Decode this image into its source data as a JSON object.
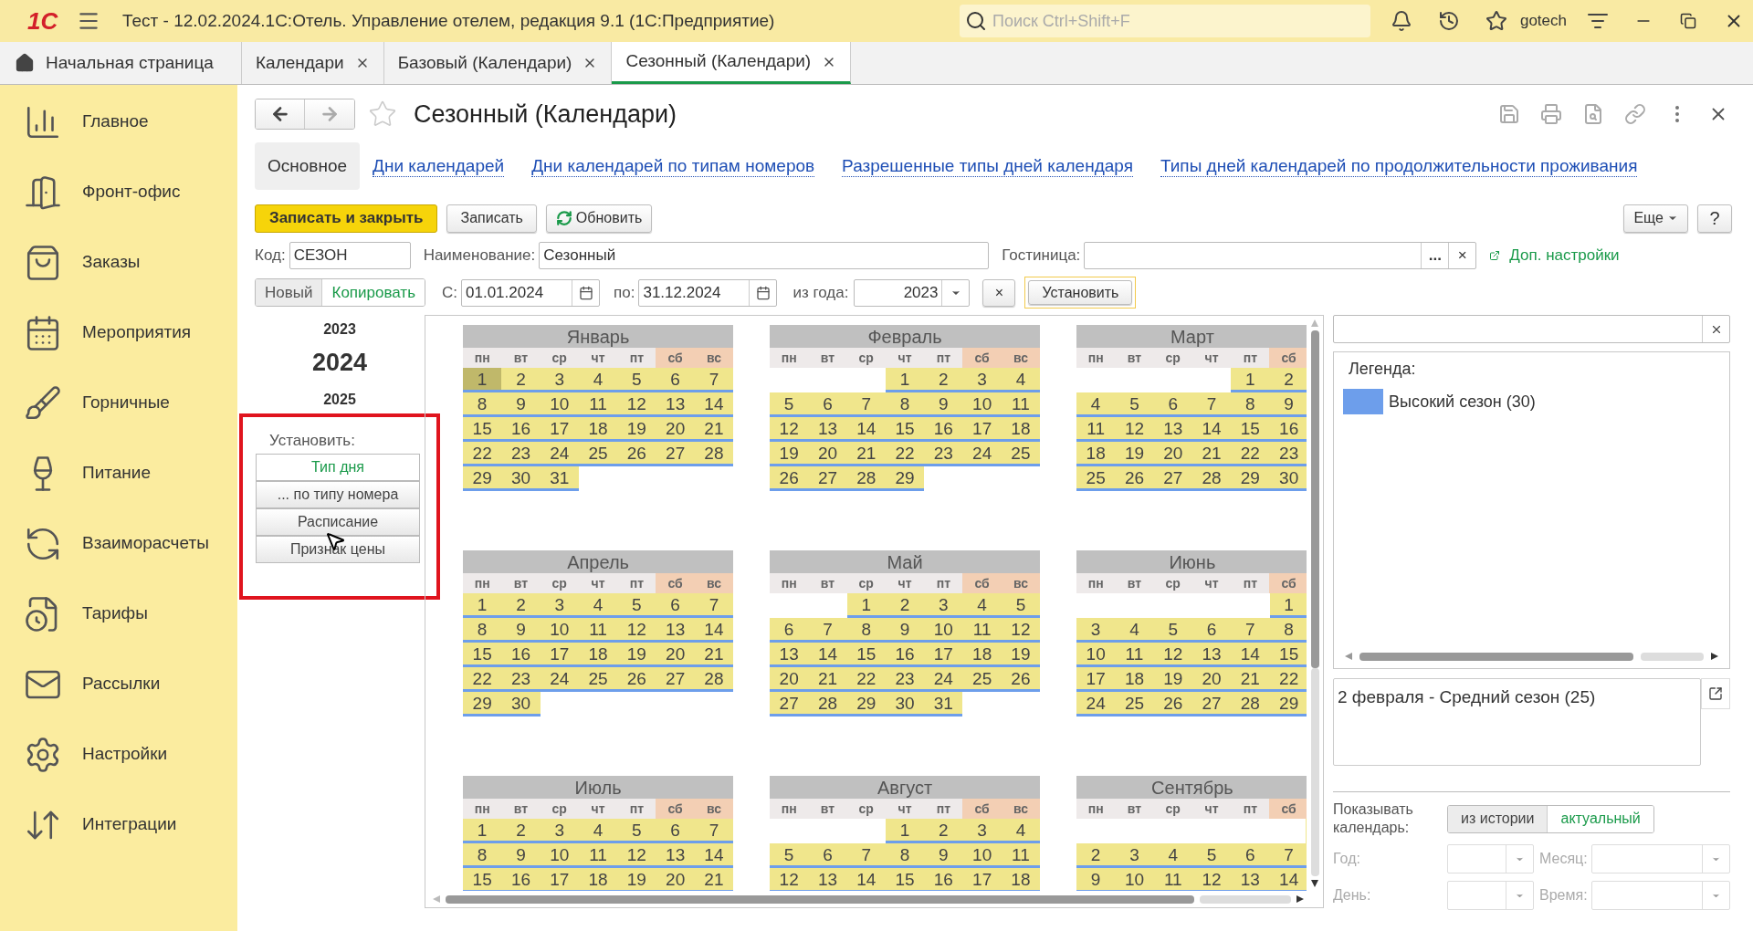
{
  "app_bar": {
    "logo": "1С",
    "title": "Тест - 12.02.2024.1С:Отель. Управление отелем, редакция 9.1  (1С:Предприятие)",
    "search": {
      "placeholder": "Поиск Ctrl+Shift+F"
    },
    "user": "gotech"
  },
  "open_tabs": [
    {
      "label": "Начальная страница",
      "kind": "home",
      "selected": false
    },
    {
      "label": "Календари",
      "kind": "doc",
      "selected": false
    },
    {
      "label": "Базовый (Календари)",
      "kind": "doc",
      "selected": false
    },
    {
      "label": "Сезонный (Календари)",
      "kind": "doc",
      "selected": true
    }
  ],
  "sidebar": {
    "items": [
      {
        "label": "Главное"
      },
      {
        "label": "Фронт-офис"
      },
      {
        "label": "Заказы"
      },
      {
        "label": "Мероприятия"
      },
      {
        "label": "Горничные"
      },
      {
        "label": "Питание"
      },
      {
        "label": "Взаиморасчеты"
      },
      {
        "label": "Тарифы"
      },
      {
        "label": "Рассылки"
      },
      {
        "label": "Настройки"
      },
      {
        "label": "Интеграции"
      }
    ]
  },
  "form": {
    "title": "Сезонный (Календари)",
    "sections": [
      {
        "label": "Основное",
        "selected": true
      },
      {
        "label": "Дни календарей",
        "selected": false
      },
      {
        "label": "Дни календарей по типам номеров",
        "selected": false
      },
      {
        "label": "Разрешенные типы дней календаря",
        "selected": false
      },
      {
        "label": "Типы дней календарей по продолжительности проживания",
        "selected": false
      }
    ],
    "commands": {
      "save_close": "Записать и закрыть",
      "save": "Записать",
      "refresh": "Обновить",
      "more": "Еще",
      "help": "?"
    },
    "fields": {
      "code_label": "Код:",
      "code": "СЕЗОН",
      "name_label": "Наименование:",
      "name": "Сезонный",
      "hotel_label": "Гостиница:",
      "hotel_choose": "...",
      "hotel_clear": "×",
      "extra_settings": "Доп. настройки"
    },
    "mode_toggle": [
      {
        "label": "Новый",
        "selected": false
      },
      {
        "label": "Копировать",
        "selected": true
      }
    ],
    "period": {
      "from_label": "С:",
      "from": "01.01.2024",
      "to_label": "по:",
      "to": "31.12.2024",
      "year_label": "из года:",
      "year": "2023",
      "clear": "×",
      "apply": "Установить"
    },
    "years": [
      {
        "label": "2023",
        "selected": false
      },
      {
        "label": "2024",
        "selected": true
      },
      {
        "label": "2025",
        "selected": false
      }
    ],
    "set_label": "Установить:",
    "set_buttons": [
      {
        "label": "Тип дня",
        "selected": true
      },
      {
        "label": "... по типу номера",
        "selected": false
      },
      {
        "label": "Расписание",
        "selected": false
      },
      {
        "label": "Признак цены",
        "selected": false
      }
    ],
    "months": [
      {
        "title": "Январь",
        "weekdays": [
          {
            "label": "пн",
            "weekend": false
          },
          {
            "label": "вт",
            "weekend": false
          },
          {
            "label": "ср",
            "weekend": false
          },
          {
            "label": "чт",
            "weekend": false
          },
          {
            "label": "пт",
            "weekend": false
          },
          {
            "label": "сб",
            "weekend": true
          },
          {
            "label": "вс",
            "weekend": true
          }
        ],
        "weeks": [
          [
            {
              "day": "1",
              "selected": true
            },
            {
              "day": "2",
              "selected": false
            },
            {
              "day": "3",
              "selected": false
            },
            {
              "day": "4",
              "selected": false
            },
            {
              "day": "5",
              "selected": false
            },
            {
              "day": "6",
              "selected": false
            },
            {
              "day": "7",
              "selected": false
            }
          ],
          [
            {
              "day": "8",
              "selected": false
            },
            {
              "day": "9",
              "selected": false
            },
            {
              "day": "10",
              "selected": false
            },
            {
              "day": "11",
              "selected": false
            },
            {
              "day": "12",
              "selected": false
            },
            {
              "day": "13",
              "selected": false
            },
            {
              "day": "14",
              "selected": false
            }
          ],
          [
            {
              "day": "15",
              "selected": false
            },
            {
              "day": "16",
              "selected": false
            },
            {
              "day": "17",
              "selected": false
            },
            {
              "day": "18",
              "selected": false
            },
            {
              "day": "19",
              "selected": false
            },
            {
              "day": "20",
              "selected": false
            },
            {
              "day": "21",
              "selected": false
            }
          ],
          [
            {
              "day": "22",
              "selected": false
            },
            {
              "day": "23",
              "selected": false
            },
            {
              "day": "24",
              "selected": false
            },
            {
              "day": "25",
              "selected": false
            },
            {
              "day": "26",
              "selected": false
            },
            {
              "day": "27",
              "selected": false
            },
            {
              "day": "28",
              "selected": false
            }
          ],
          [
            {
              "day": "29",
              "selected": false
            },
            {
              "day": "30",
              "selected": false
            },
            {
              "day": "31",
              "selected": false
            }
          ]
        ]
      },
      {
        "title": "Февраль",
        "weekdays": [
          {
            "label": "пн",
            "weekend": false
          },
          {
            "label": "вт",
            "weekend": false
          },
          {
            "label": "ср",
            "weekend": false
          },
          {
            "label": "чт",
            "weekend": false
          },
          {
            "label": "пт",
            "weekend": false
          },
          {
            "label": "сб",
            "weekend": true
          },
          {
            "label": "вс",
            "weekend": true
          }
        ],
        "weeks": [
          [
            {
              "day": "1",
              "selected": false
            },
            {
              "day": "2",
              "selected": false
            },
            {
              "day": "3",
              "selected": false
            },
            {
              "day": "4",
              "selected": false
            }
          ],
          [
            {
              "day": "5",
              "selected": false
            },
            {
              "day": "6",
              "selected": false
            },
            {
              "day": "7",
              "selected": false
            },
            {
              "day": "8",
              "selected": false
            },
            {
              "day": "9",
              "selected": false
            },
            {
              "day": "10",
              "selected": false
            },
            {
              "day": "11",
              "selected": false
            }
          ],
          [
            {
              "day": "12",
              "selected": false
            },
            {
              "day": "13",
              "selected": false
            },
            {
              "day": "14",
              "selected": false
            },
            {
              "day": "15",
              "selected": false
            },
            {
              "day": "16",
              "selected": false
            },
            {
              "day": "17",
              "selected": false
            },
            {
              "day": "18",
              "selected": false
            }
          ],
          [
            {
              "day": "19",
              "selected": false
            },
            {
              "day": "20",
              "selected": false
            },
            {
              "day": "21",
              "selected": false
            },
            {
              "day": "22",
              "selected": false
            },
            {
              "day": "23",
              "selected": false
            },
            {
              "day": "24",
              "selected": false
            },
            {
              "day": "25",
              "selected": false
            }
          ],
          [
            {
              "day": "26",
              "selected": false
            },
            {
              "day": "27",
              "selected": false
            },
            {
              "day": "28",
              "selected": false
            },
            {
              "day": "29",
              "selected": false
            }
          ]
        ]
      },
      {
        "title": "Март",
        "weekdays": [
          {
            "label": "пн",
            "weekend": false
          },
          {
            "label": "вт",
            "weekend": false
          },
          {
            "label": "ср",
            "weekend": false
          },
          {
            "label": "чт",
            "weekend": false
          },
          {
            "label": "пт",
            "weekend": false
          },
          {
            "label": "сб",
            "weekend": true
          }
        ],
        "weeks": [
          [
            {
              "day": "1",
              "selected": false
            },
            {
              "day": "2",
              "selected": false
            }
          ],
          [
            {
              "day": "4",
              "selected": false
            },
            {
              "day": "5",
              "selected": false
            },
            {
              "day": "6",
              "selected": false
            },
            {
              "day": "7",
              "selected": false
            },
            {
              "day": "8",
              "selected": false
            },
            {
              "day": "9",
              "selected": false
            }
          ],
          [
            {
              "day": "11",
              "selected": false
            },
            {
              "day": "12",
              "selected": false
            },
            {
              "day": "13",
              "selected": false
            },
            {
              "day": "14",
              "selected": false
            },
            {
              "day": "15",
              "selected": false
            },
            {
              "day": "16",
              "selected": false
            }
          ],
          [
            {
              "day": "18",
              "selected": false
            },
            {
              "day": "19",
              "selected": false
            },
            {
              "day": "20",
              "selected": false
            },
            {
              "day": "21",
              "selected": false
            },
            {
              "day": "22",
              "selected": false
            },
            {
              "day": "23",
              "selected": false
            }
          ],
          [
            {
              "day": "25",
              "selected": false
            },
            {
              "day": "26",
              "selected": false
            },
            {
              "day": "27",
              "selected": false
            },
            {
              "day": "28",
              "selected": false
            },
            {
              "day": "29",
              "selected": false
            },
            {
              "day": "30",
              "selected": false
            }
          ]
        ]
      },
      {
        "title": "Апрель",
        "weekdays": [
          {
            "label": "пн",
            "weekend": false
          },
          {
            "label": "вт",
            "weekend": false
          },
          {
            "label": "ср",
            "weekend": false
          },
          {
            "label": "чт",
            "weekend": false
          },
          {
            "label": "пт",
            "weekend": false
          },
          {
            "label": "сб",
            "weekend": true
          },
          {
            "label": "вс",
            "weekend": true
          }
        ],
        "weeks": [
          [
            {
              "day": "1",
              "selected": false
            },
            {
              "day": "2",
              "selected": false
            },
            {
              "day": "3",
              "selected": false
            },
            {
              "day": "4",
              "selected": false
            },
            {
              "day": "5",
              "selected": false
            },
            {
              "day": "6",
              "selected": false
            },
            {
              "day": "7",
              "selected": false
            }
          ],
          [
            {
              "day": "8",
              "selected": false
            },
            {
              "day": "9",
              "selected": false
            },
            {
              "day": "10",
              "selected": false
            },
            {
              "day": "11",
              "selected": false
            },
            {
              "day": "12",
              "selected": false
            },
            {
              "day": "13",
              "selected": false
            },
            {
              "day": "14",
              "selected": false
            }
          ],
          [
            {
              "day": "15",
              "selected": false
            },
            {
              "day": "16",
              "selected": false
            },
            {
              "day": "17",
              "selected": false
            },
            {
              "day": "18",
              "selected": false
            },
            {
              "day": "19",
              "selected": false
            },
            {
              "day": "20",
              "selected": false
            },
            {
              "day": "21",
              "selected": false
            }
          ],
          [
            {
              "day": "22",
              "selected": false
            },
            {
              "day": "23",
              "selected": false
            },
            {
              "day": "24",
              "selected": false
            },
            {
              "day": "25",
              "selected": false
            },
            {
              "day": "26",
              "selected": false
            },
            {
              "day": "27",
              "selected": false
            },
            {
              "day": "28",
              "selected": false
            }
          ],
          [
            {
              "day": "29",
              "selected": false
            },
            {
              "day": "30",
              "selected": false
            }
          ]
        ]
      },
      {
        "title": "Май",
        "weekdays": [
          {
            "label": "пн",
            "weekend": false
          },
          {
            "label": "вт",
            "weekend": false
          },
          {
            "label": "ср",
            "weekend": false
          },
          {
            "label": "чт",
            "weekend": false
          },
          {
            "label": "пт",
            "weekend": false
          },
          {
            "label": "сб",
            "weekend": true
          },
          {
            "label": "вс",
            "weekend": true
          }
        ],
        "weeks": [
          [
            {
              "day": "1",
              "selected": false
            },
            {
              "day": "2",
              "selected": false
            },
            {
              "day": "3",
              "selected": false
            },
            {
              "day": "4",
              "selected": false
            },
            {
              "day": "5",
              "selected": false
            }
          ],
          [
            {
              "day": "6",
              "selected": false
            },
            {
              "day": "7",
              "selected": false
            },
            {
              "day": "8",
              "selected": false
            },
            {
              "day": "9",
              "selected": false
            },
            {
              "day": "10",
              "selected": false
            },
            {
              "day": "11",
              "selected": false
            },
            {
              "day": "12",
              "selected": false
            }
          ],
          [
            {
              "day": "13",
              "selected": false
            },
            {
              "day": "14",
              "selected": false
            },
            {
              "day": "15",
              "selected": false
            },
            {
              "day": "16",
              "selected": false
            },
            {
              "day": "17",
              "selected": false
            },
            {
              "day": "18",
              "selected": false
            },
            {
              "day": "19",
              "selected": false
            }
          ],
          [
            {
              "day": "20",
              "selected": false
            },
            {
              "day": "21",
              "selected": false
            },
            {
              "day": "22",
              "selected": false
            },
            {
              "day": "23",
              "selected": false
            },
            {
              "day": "24",
              "selected": false
            },
            {
              "day": "25",
              "selected": false
            },
            {
              "day": "26",
              "selected": false
            }
          ],
          [
            {
              "day": "27",
              "selected": false
            },
            {
              "day": "28",
              "selected": false
            },
            {
              "day": "29",
              "selected": false
            },
            {
              "day": "30",
              "selected": false
            },
            {
              "day": "31",
              "selected": false
            }
          ]
        ]
      },
      {
        "title": "Июнь",
        "weekdays": [
          {
            "label": "пн",
            "weekend": false
          },
          {
            "label": "вт",
            "weekend": false
          },
          {
            "label": "ср",
            "weekend": false
          },
          {
            "label": "чт",
            "weekend": false
          },
          {
            "label": "пт",
            "weekend": false
          },
          {
            "label": "сб",
            "weekend": true
          }
        ],
        "weeks": [
          [
            {
              "day": "1",
              "selected": false
            }
          ],
          [
            {
              "day": "3",
              "selected": false
            },
            {
              "day": "4",
              "selected": false
            },
            {
              "day": "5",
              "selected": false
            },
            {
              "day": "6",
              "selected": false
            },
            {
              "day": "7",
              "selected": false
            },
            {
              "day": "8",
              "selected": false
            }
          ],
          [
            {
              "day": "10",
              "selected": false
            },
            {
              "day": "11",
              "selected": false
            },
            {
              "day": "12",
              "selected": false
            },
            {
              "day": "13",
              "selected": false
            },
            {
              "day": "14",
              "selected": false
            },
            {
              "day": "15",
              "selected": false
            }
          ],
          [
            {
              "day": "17",
              "selected": false
            },
            {
              "day": "18",
              "selected": false
            },
            {
              "day": "19",
              "selected": false
            },
            {
              "day": "20",
              "selected": false
            },
            {
              "day": "21",
              "selected": false
            },
            {
              "day": "22",
              "selected": false
            }
          ],
          [
            {
              "day": "24",
              "selected": false
            },
            {
              "day": "25",
              "selected": false
            },
            {
              "day": "26",
              "selected": false
            },
            {
              "day": "27",
              "selected": false
            },
            {
              "day": "28",
              "selected": false
            },
            {
              "day": "29",
              "selected": false
            }
          ]
        ]
      },
      {
        "title": "Июль",
        "weekdays": [
          {
            "label": "пн",
            "weekend": false
          },
          {
            "label": "вт",
            "weekend": false
          },
          {
            "label": "ср",
            "weekend": false
          },
          {
            "label": "чт",
            "weekend": false
          },
          {
            "label": "пт",
            "weekend": false
          },
          {
            "label": "сб",
            "weekend": true
          },
          {
            "label": "вс",
            "weekend": true
          }
        ],
        "weeks": [
          [
            {
              "day": "1",
              "selected": false
            },
            {
              "day": "2",
              "selected": false
            },
            {
              "day": "3",
              "selected": false
            },
            {
              "day": "4",
              "selected": false
            },
            {
              "day": "5",
              "selected": false
            },
            {
              "day": "6",
              "selected": false
            },
            {
              "day": "7",
              "selected": false
            }
          ],
          [
            {
              "day": "8",
              "selected": false
            },
            {
              "day": "9",
              "selected": false
            },
            {
              "day": "10",
              "selected": false
            },
            {
              "day": "11",
              "selected": false
            },
            {
              "day": "12",
              "selected": false
            },
            {
              "day": "13",
              "selected": false
            },
            {
              "day": "14",
              "selected": false
            }
          ],
          [
            {
              "day": "15",
              "selected": false
            },
            {
              "day": "16",
              "selected": false
            },
            {
              "day": "17",
              "selected": false
            },
            {
              "day": "18",
              "selected": false
            },
            {
              "day": "19",
              "selected": false
            },
            {
              "day": "20",
              "selected": false
            },
            {
              "day": "21",
              "selected": false
            }
          ]
        ]
      },
      {
        "title": "Август",
        "weekdays": [
          {
            "label": "пн",
            "weekend": false
          },
          {
            "label": "вт",
            "weekend": false
          },
          {
            "label": "ср",
            "weekend": false
          },
          {
            "label": "чт",
            "weekend": false
          },
          {
            "label": "пт",
            "weekend": false
          },
          {
            "label": "сб",
            "weekend": true
          },
          {
            "label": "вс",
            "weekend": true
          }
        ],
        "weeks": [
          [
            {
              "day": "1",
              "selected": false
            },
            {
              "day": "2",
              "selected": false
            },
            {
              "day": "3",
              "selected": false
            },
            {
              "day": "4",
              "selected": false
            }
          ],
          [
            {
              "day": "5",
              "selected": false
            },
            {
              "day": "6",
              "selected": false
            },
            {
              "day": "7",
              "selected": false
            },
            {
              "day": "8",
              "selected": false
            },
            {
              "day": "9",
              "selected": false
            },
            {
              "day": "10",
              "selected": false
            },
            {
              "day": "11",
              "selected": false
            }
          ],
          [
            {
              "day": "12",
              "selected": false
            },
            {
              "day": "13",
              "selected": false
            },
            {
              "day": "14",
              "selected": false
            },
            {
              "day": "15",
              "selected": false
            },
            {
              "day": "16",
              "selected": false
            },
            {
              "day": "17",
              "selected": false
            },
            {
              "day": "18",
              "selected": false
            }
          ]
        ]
      },
      {
        "title": "Сентябрь",
        "weekdays": [
          {
            "label": "пн",
            "weekend": false
          },
          {
            "label": "вт",
            "weekend": false
          },
          {
            "label": "ср",
            "weekend": false
          },
          {
            "label": "чт",
            "weekend": false
          },
          {
            "label": "пт",
            "weekend": false
          },
          {
            "label": "сб",
            "weekend": true
          }
        ],
        "weeks": [
          {
            "kind": "blank"
          },
          [
            {
              "day": "2",
              "selected": false
            },
            {
              "day": "3",
              "selected": false
            },
            {
              "day": "4",
              "selected": false
            },
            {
              "day": "5",
              "selected": false
            },
            {
              "day": "6",
              "selected": false
            },
            {
              "day": "7",
              "selected": false
            }
          ],
          [
            {
              "day": "9",
              "selected": false
            },
            {
              "day": "10",
              "selected": false
            },
            {
              "day": "11",
              "selected": false
            },
            {
              "day": "12",
              "selected": false
            },
            {
              "day": "13",
              "selected": false
            },
            {
              "day": "14",
              "selected": false
            }
          ]
        ]
      }
    ],
    "legend": {
      "title": "Легенда:",
      "items": [
        {
          "label": "Высокий сезон (30)",
          "color": "#6d9eeb"
        }
      ]
    },
    "day_info": "2 февраля - Средний сезон (25)",
    "show": {
      "label": "Показывать календарь:",
      "options": [
        {
          "label": "из истории",
          "selected": false
        },
        {
          "label": "актуальный",
          "selected": true
        }
      ],
      "filters": [
        {
          "label": "Год:",
          "disabled": true
        },
        {
          "label": "Месяц:",
          "disabled": true
        },
        {
          "label": "День:",
          "disabled": true
        },
        {
          "label": "Время:",
          "disabled": true
        }
      ]
    }
  }
}
